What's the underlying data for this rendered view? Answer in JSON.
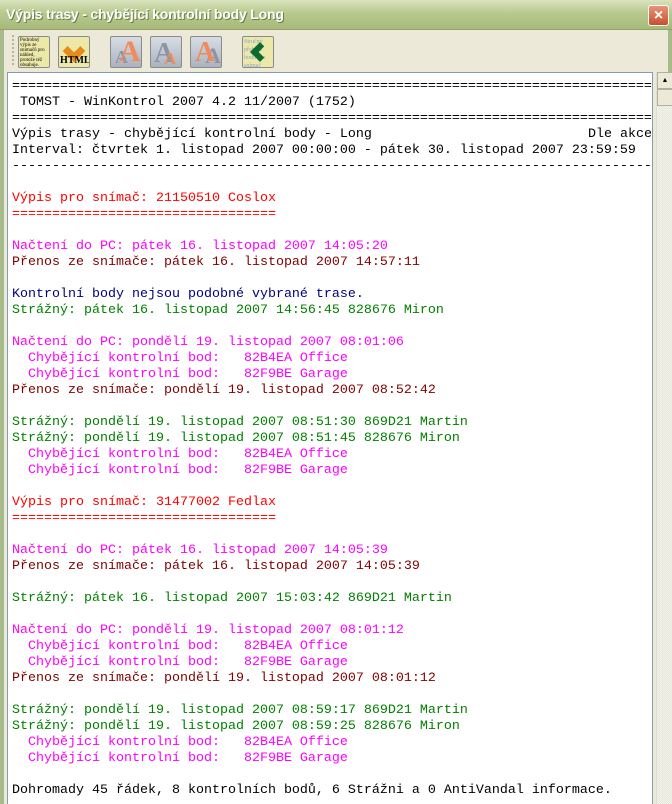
{
  "window": {
    "title": "Výpis trasy - chybějící kontrolní body Long",
    "close_icon": "×"
  },
  "toolbar": {
    "detail_button_text": "Podrobný výpis ze snímačů pro náhled, protože též obsahuje.",
    "html_label": "HTML",
    "font_buttons": [
      "A",
      "A",
      "A"
    ],
    "back_button_text": "Stručný přehled bodů pro snímač"
  },
  "report": {
    "header_right": "Dle akce",
    "lines": [
      {
        "text": "================================================================================",
        "color": "black"
      },
      {
        "text": " TOMST - WinKontrol 2007 4.2 11/2007 (1752)",
        "color": "black"
      },
      {
        "text": "================================================================================",
        "color": "black"
      },
      {
        "text": "Výpis trasy - chybějící kontrolní body - Long",
        "color": "black"
      },
      {
        "text": "Interval: čtvrtek 1. listopad 2007 00:00:00 - pátek 30. listopad 2007 23:59:59",
        "color": "black"
      },
      {
        "text": "--------------------------------------------------------------------------------",
        "color": "black"
      },
      {
        "text": "",
        "color": "black"
      },
      {
        "text": "Výpis pro snímač: 21150510 Coslox",
        "color": "red"
      },
      {
        "text": "=================================",
        "color": "red"
      },
      {
        "text": "",
        "color": "black"
      },
      {
        "text": "Načtení do PC: pátek 16. listopad 2007 14:05:20",
        "color": "magenta"
      },
      {
        "text": "Přenos ze snímače: pátek 16. listopad 2007 14:57:11",
        "color": "darkred"
      },
      {
        "text": "",
        "color": "black"
      },
      {
        "text": "Kontrolní body nejsou podobné vybrané trase.",
        "color": "navy"
      },
      {
        "text": "Strážný: pátek 16. listopad 2007 14:56:45 828676 Miron",
        "color": "green"
      },
      {
        "text": "",
        "color": "black"
      },
      {
        "text": "Načtení do PC: pondělí 19. listopad 2007 08:01:06",
        "color": "magenta"
      },
      {
        "text": "  Chybějící kontrolní bod:   82B4EA Office",
        "color": "magenta"
      },
      {
        "text": "  Chybějící kontrolní bod:   82F9BE Garage",
        "color": "magenta"
      },
      {
        "text": "Přenos ze snímače: pondělí 19. listopad 2007 08:52:42",
        "color": "darkred"
      },
      {
        "text": "",
        "color": "black"
      },
      {
        "text": "Strážný: pondělí 19. listopad 2007 08:51:30 869D21 Martin",
        "color": "green"
      },
      {
        "text": "Strážný: pondělí 19. listopad 2007 08:51:45 828676 Miron",
        "color": "green"
      },
      {
        "text": "  Chybějící kontrolní bod:   82B4EA Office",
        "color": "magenta"
      },
      {
        "text": "  Chybějící kontrolní bod:   82F9BE Garage",
        "color": "magenta"
      },
      {
        "text": "",
        "color": "black"
      },
      {
        "text": "Výpis pro snímač: 31477002 Fedlax",
        "color": "red"
      },
      {
        "text": "=================================",
        "color": "red"
      },
      {
        "text": "",
        "color": "black"
      },
      {
        "text": "Načtení do PC: pátek 16. listopad 2007 14:05:39",
        "color": "magenta"
      },
      {
        "text": "Přenos ze snímače: pátek 16. listopad 2007 14:05:39",
        "color": "darkred"
      },
      {
        "text": "",
        "color": "black"
      },
      {
        "text": "Strážný: pátek 16. listopad 2007 15:03:42 869D21 Martin",
        "color": "green"
      },
      {
        "text": "",
        "color": "black"
      },
      {
        "text": "Načtení do PC: pondělí 19. listopad 2007 08:01:12",
        "color": "magenta"
      },
      {
        "text": "  Chybějící kontrolní bod:   82B4EA Office",
        "color": "magenta"
      },
      {
        "text": "  Chybějící kontrolní bod:   82F9BE Garage",
        "color": "magenta"
      },
      {
        "text": "Přenos ze snímače: pondělí 19. listopad 2007 08:01:12",
        "color": "darkred"
      },
      {
        "text": "",
        "color": "black"
      },
      {
        "text": "Strážný: pondělí 19. listopad 2007 08:59:17 869D21 Martin",
        "color": "green"
      },
      {
        "text": "Strážný: pondělí 19. listopad 2007 08:59:25 828676 Miron",
        "color": "green"
      },
      {
        "text": "  Chybějící kontrolní bod:   82B4EA Office",
        "color": "magenta"
      },
      {
        "text": "  Chybějící kontrolní bod:   82F9BE Garage",
        "color": "magenta"
      },
      {
        "text": "",
        "color": "black"
      },
      {
        "text": "Dohromady 45 řádek, 8 kontrolních bodů, 6 Strážni a 0 AntiVandal informace.",
        "color": "black"
      }
    ]
  },
  "colors": {
    "red": "#ff0000",
    "magenta": "#ff00ff",
    "darkred": "#800000",
    "navy": "#000080",
    "green": "#008000",
    "titlebar": "#b8c98e"
  },
  "scrollbar": {
    "up_icon": "▲"
  }
}
